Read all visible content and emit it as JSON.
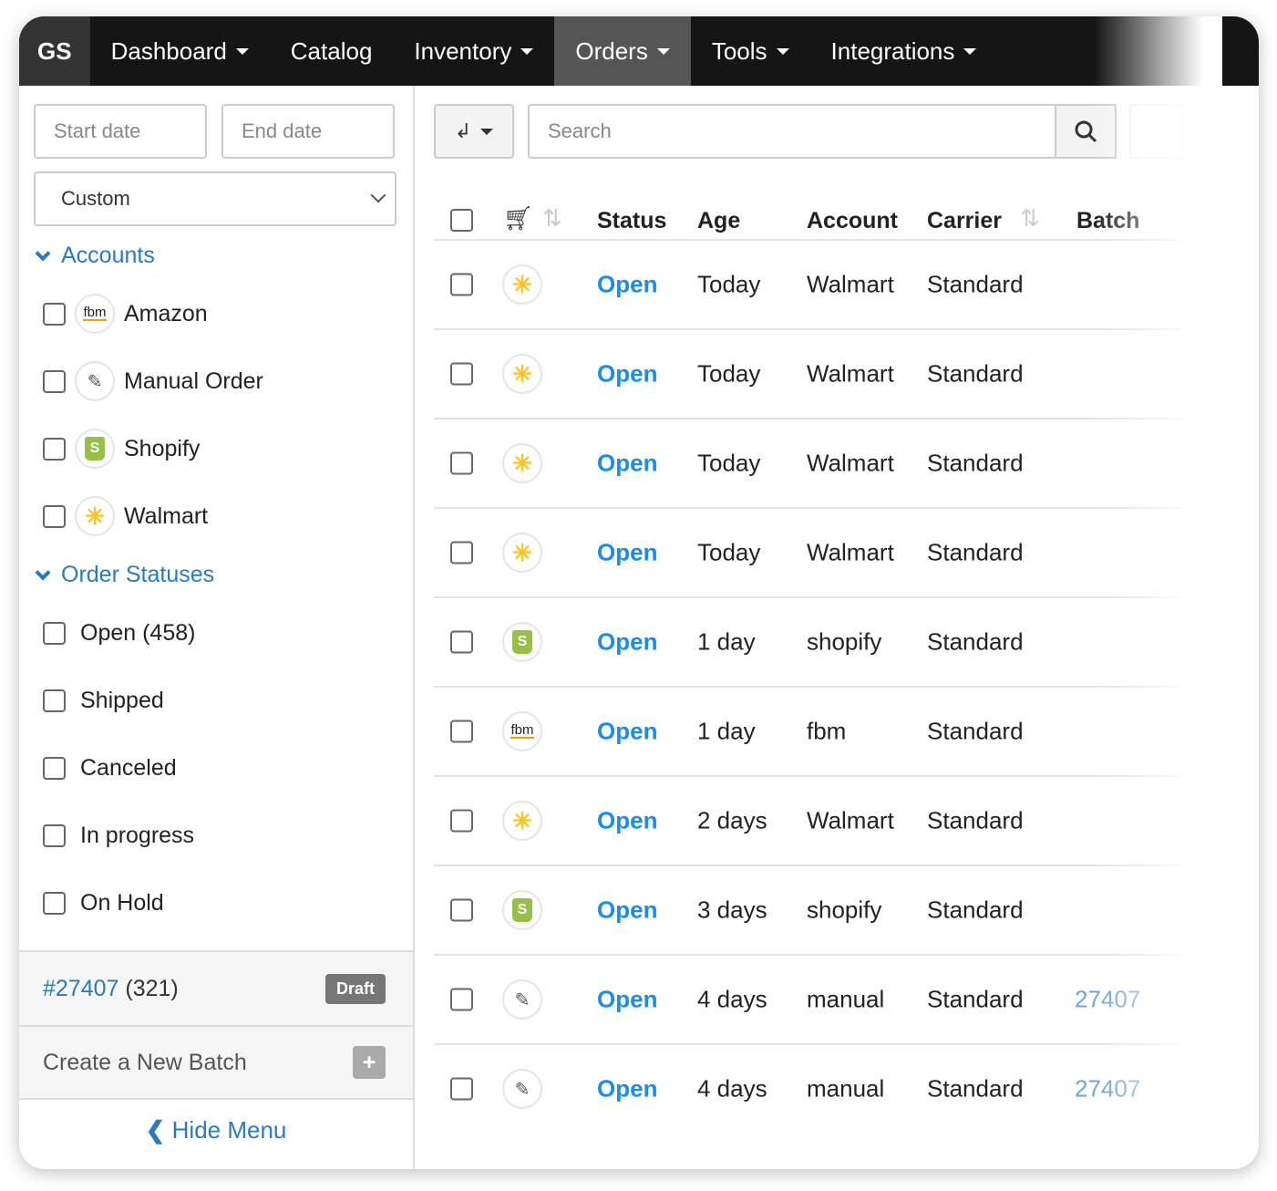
{
  "nav": {
    "brand": "GS",
    "items": [
      {
        "label": "Dashboard",
        "caret": true
      },
      {
        "label": "Catalog",
        "caret": false
      },
      {
        "label": "Inventory",
        "caret": true
      },
      {
        "label": "Orders",
        "caret": true,
        "active": true
      },
      {
        "label": "Tools",
        "caret": true
      },
      {
        "label": "Integrations",
        "caret": true
      }
    ]
  },
  "filters": {
    "start_placeholder": "Start date",
    "end_placeholder": "End date",
    "range": "Custom"
  },
  "accounts": {
    "title": "Accounts",
    "items": [
      {
        "label": "Amazon",
        "logo": "fbm"
      },
      {
        "label": "Manual Order",
        "logo": "edit"
      },
      {
        "label": "Shopify",
        "logo": "shopify"
      },
      {
        "label": "Walmart",
        "logo": "walmart"
      }
    ]
  },
  "statuses": {
    "title": "Order Statuses",
    "items": [
      "Open (458)",
      "Shipped",
      "Canceled",
      "In progress",
      "On Hold"
    ]
  },
  "batch": {
    "id": "#27407",
    "count": "(321)",
    "badge": "Draft",
    "create": "Create a New Batch",
    "plus": "+"
  },
  "hide_menu": "Hide Menu",
  "search": {
    "placeholder": "Search"
  },
  "table": {
    "headers": {
      "status": "Status",
      "age": "Age",
      "account": "Account",
      "carrier": "Carrier",
      "batch": "Batch"
    },
    "rows": [
      {
        "logo": "walmart",
        "status": "Open",
        "age": "Today",
        "account": "Walmart",
        "carrier": "Standard",
        "batch": ""
      },
      {
        "logo": "walmart",
        "status": "Open",
        "age": "Today",
        "account": "Walmart",
        "carrier": "Standard",
        "batch": ""
      },
      {
        "logo": "walmart",
        "status": "Open",
        "age": "Today",
        "account": "Walmart",
        "carrier": "Standard",
        "batch": ""
      },
      {
        "logo": "walmart",
        "status": "Open",
        "age": "Today",
        "account": "Walmart",
        "carrier": "Standard",
        "batch": ""
      },
      {
        "logo": "shopify",
        "status": "Open",
        "age": "1 day",
        "account": "shopify",
        "carrier": "Standard",
        "batch": ""
      },
      {
        "logo": "fbm",
        "status": "Open",
        "age": "1 day",
        "account": "fbm",
        "carrier": "Standard",
        "batch": ""
      },
      {
        "logo": "walmart",
        "status": "Open",
        "age": "2 days",
        "account": "Walmart",
        "carrier": "Standard",
        "batch": ""
      },
      {
        "logo": "shopify",
        "status": "Open",
        "age": "3 days",
        "account": "shopify",
        "carrier": "Standard",
        "batch": ""
      },
      {
        "logo": "edit",
        "status": "Open",
        "age": "4 days",
        "account": "manual",
        "carrier": "Standard",
        "batch": "27407"
      },
      {
        "logo": "edit",
        "status": "Open",
        "age": "4 days",
        "account": "manual",
        "carrier": "Standard",
        "batch": "27407"
      }
    ]
  },
  "colors": {
    "link": "#2a7ac0",
    "open": "#1a8cf0",
    "nav": "#151515"
  }
}
